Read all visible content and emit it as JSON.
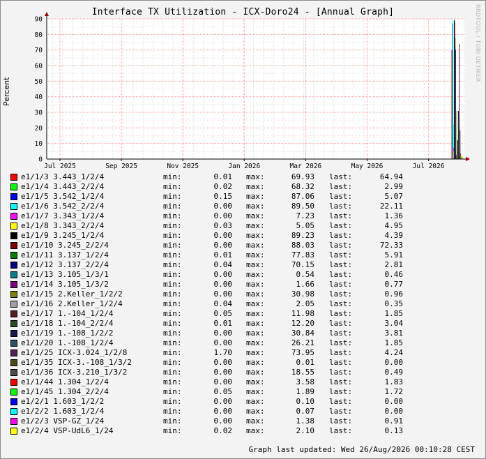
{
  "chart_data": {
    "type": "line",
    "title": "Interface TX Utilization - ICX-Doro24 - [Annual Graph]",
    "ylabel": "Percent",
    "ylim": [
      0,
      90
    ],
    "yticks": [
      0,
      10,
      20,
      30,
      40,
      50,
      60,
      70,
      80,
      90
    ],
    "xticks": [
      "Jul 2025",
      "Sep 2025",
      "Nov 2025",
      "Jan 2026",
      "Mar 2026",
      "May 2026",
      "Jul 2026"
    ],
    "grid": true,
    "legend_placement": "below",
    "series": [
      {
        "name": "e1/1/3 3.443_1/2/4",
        "color": "#ff0000",
        "min": "0.01",
        "max": "69.93",
        "last": "64.94"
      },
      {
        "name": "e1/1/4 3.443_2/2/4",
        "color": "#00ff00",
        "min": "0.02",
        "max": "68.32",
        "last": "2.99"
      },
      {
        "name": "e1/1/5 3.542_1/2/4",
        "color": "#0000ff",
        "min": "0.15",
        "max": "87.06",
        "last": "5.07"
      },
      {
        "name": "e1/1/6 3.542_2/2/4",
        "color": "#00ffff",
        "min": "0.00",
        "max": "89.50",
        "last": "22.11"
      },
      {
        "name": "e1/1/7 3.343_1/2/4",
        "color": "#ff00ff",
        "min": "0.00",
        "max": "7.23",
        "last": "1.36"
      },
      {
        "name": "e1/1/8 3.343_2/2/4",
        "color": "#ffff00",
        "min": "0.03",
        "max": "5.05",
        "last": "4.95"
      },
      {
        "name": "e1/1/9 3.245_1/2/4",
        "color": "#000000",
        "min": "0.00",
        "max": "89.23",
        "last": "4.39"
      },
      {
        "name": "e1/1/10 3.245_2/2/4",
        "color": "#800000",
        "min": "0.00",
        "max": "88.03",
        "last": "72.33"
      },
      {
        "name": "e1/1/11 3.137_1/2/4",
        "color": "#008000",
        "min": "0.01",
        "max": "77.83",
        "last": "5.91"
      },
      {
        "name": "e1/1/12 3.137_2/2/4",
        "color": "#000080",
        "min": "0.04",
        "max": "70.15",
        "last": "2.81"
      },
      {
        "name": "e1/1/13 3.105_1/3/1",
        "color": "#008080",
        "min": "0.00",
        "max": "0.54",
        "last": "0.46"
      },
      {
        "name": "e1/1/14 3.105_1/3/2",
        "color": "#800080",
        "min": "0.00",
        "max": "1.66",
        "last": "0.77"
      },
      {
        "name": "e1/1/15 2.Keller_1/2/2",
        "color": "#808000",
        "min": "0.00",
        "max": "30.98",
        "last": "0.96"
      },
      {
        "name": "e1/1/16 2.Keller_1/2/4",
        "color": "#a0a0a0",
        "min": "0.04",
        "max": "2.05",
        "last": "0.35"
      },
      {
        "name": "e1/1/17 1.-104_1/2/4",
        "color": "#502020",
        "min": "0.05",
        "max": "11.98",
        "last": "1.85"
      },
      {
        "name": "e1/1/18 1.-104_2/2/4",
        "color": "#2a4a2a",
        "min": "0.01",
        "max": "12.20",
        "last": "3.04"
      },
      {
        "name": "e1/1/19 1.-108_1/2/2",
        "color": "#1a1a50",
        "min": "0.00",
        "max": "30.84",
        "last": "3.81"
      },
      {
        "name": "e1/1/20 1.-108_1/2/4",
        "color": "#2a5060",
        "min": "0.00",
        "max": "26.21",
        "last": "1.85"
      },
      {
        "name": "e1/1/25 ICX-3.024_1/2/8",
        "color": "#502050",
        "min": "1.70",
        "max": "73.95",
        "last": "4.24"
      },
      {
        "name": "e1/1/35 ICX-3.-108_1/3/2",
        "color": "#4a4a20",
        "min": "0.00",
        "max": "0.01",
        "last": "0.00"
      },
      {
        "name": "e1/1/36 ICX-3.210_1/3/2",
        "color": "#4a4a4a",
        "min": "0.00",
        "max": "18.55",
        "last": "0.49"
      },
      {
        "name": "e1/1/44 1.304_1/2/4",
        "color": "#ff0000",
        "min": "0.00",
        "max": "3.58",
        "last": "1.83"
      },
      {
        "name": "e1/1/45 1.304_2/2/4",
        "color": "#00ff00",
        "min": "0.05",
        "max": "1.89",
        "last": "1.72"
      },
      {
        "name": "e1/2/1 1.603_1/2/2",
        "color": "#0000ff",
        "min": "0.00",
        "max": "0.10",
        "last": "0.00"
      },
      {
        "name": "e1/2/2 1.603_1/2/4",
        "color": "#00ffff",
        "min": "0.00",
        "max": "0.07",
        "last": "0.00"
      },
      {
        "name": "e1/2/3 VSP-GZ_1/24",
        "color": "#ff00ff",
        "min": "0.00",
        "max": "1.38",
        "last": "0.91"
      },
      {
        "name": "e1/2/4 VSP-UdL6_1/24",
        "color": "#ffff00",
        "min": "0.02",
        "max": "2.10",
        "last": "0.13"
      }
    ]
  },
  "labels": {
    "min": "min:",
    "max": "max:",
    "last": "last:"
  },
  "footer": {
    "updated": "Graph last updated: Wed 26/Aug/2026 00:10:28 CEST"
  },
  "watermark": "RRDTOOL / TOBI OETIKER"
}
